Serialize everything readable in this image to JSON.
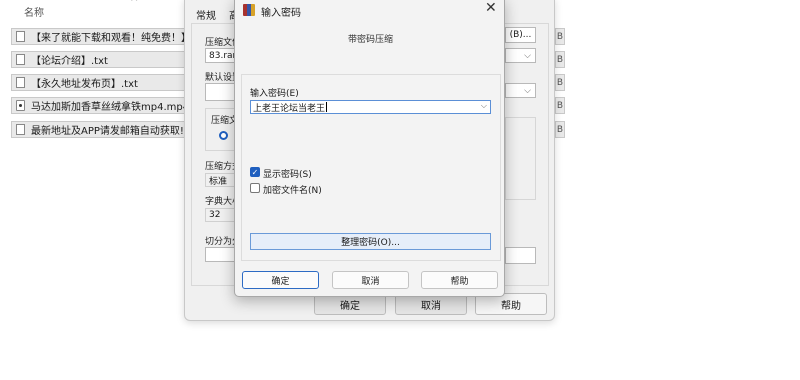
{
  "file_list": {
    "column_header": "名称",
    "files": [
      {
        "name": "【来了就能下载和观看！纯免费！】",
        "icon": "text-file-icon"
      },
      {
        "name": "【论坛介绍】.txt",
        "icon": "text-file-icon"
      },
      {
        "name": "【永久地址发布页】.txt",
        "icon": "text-file-icon"
      },
      {
        "name": "马达加斯加香草丝绒拿铁mp4.mp4",
        "icon": "video-file-icon"
      },
      {
        "name": "最新地址及APP请发邮箱自动获取!",
        "icon": "text-file-icon"
      }
    ],
    "right_strip_letter": "B"
  },
  "archive_dialog": {
    "tab_general": "常规",
    "tab_partial": "高",
    "archive_name_label": "压缩文件",
    "archive_name_value": "83.rar",
    "browse_button": "(B)...",
    "default_settings_label": "默认设置",
    "format_label": "压缩文",
    "method_label": "压缩方式",
    "method_value": "标准",
    "dict_label": "字典大小",
    "dict_value": "32",
    "split_label": "切分为分卷",
    "ok_button": "确定",
    "cancel_button": "取消",
    "help_button": "帮助"
  },
  "password_dialog": {
    "title": "输入密码",
    "heading": "带密码压缩",
    "password_label": "输入密码(E)",
    "password_value": "上老王论坛当老王",
    "show_password": {
      "label": "显示密码(S)",
      "checked": true
    },
    "encrypt_names": {
      "label": "加密文件名(N)",
      "checked": false
    },
    "manage_button": "整理密码(O)...",
    "ok_button": "确定",
    "cancel_button": "取消",
    "help_button": "帮助",
    "close_glyph": "✕",
    "chevron_glyph": "⌵",
    "check_glyph": "✓"
  }
}
